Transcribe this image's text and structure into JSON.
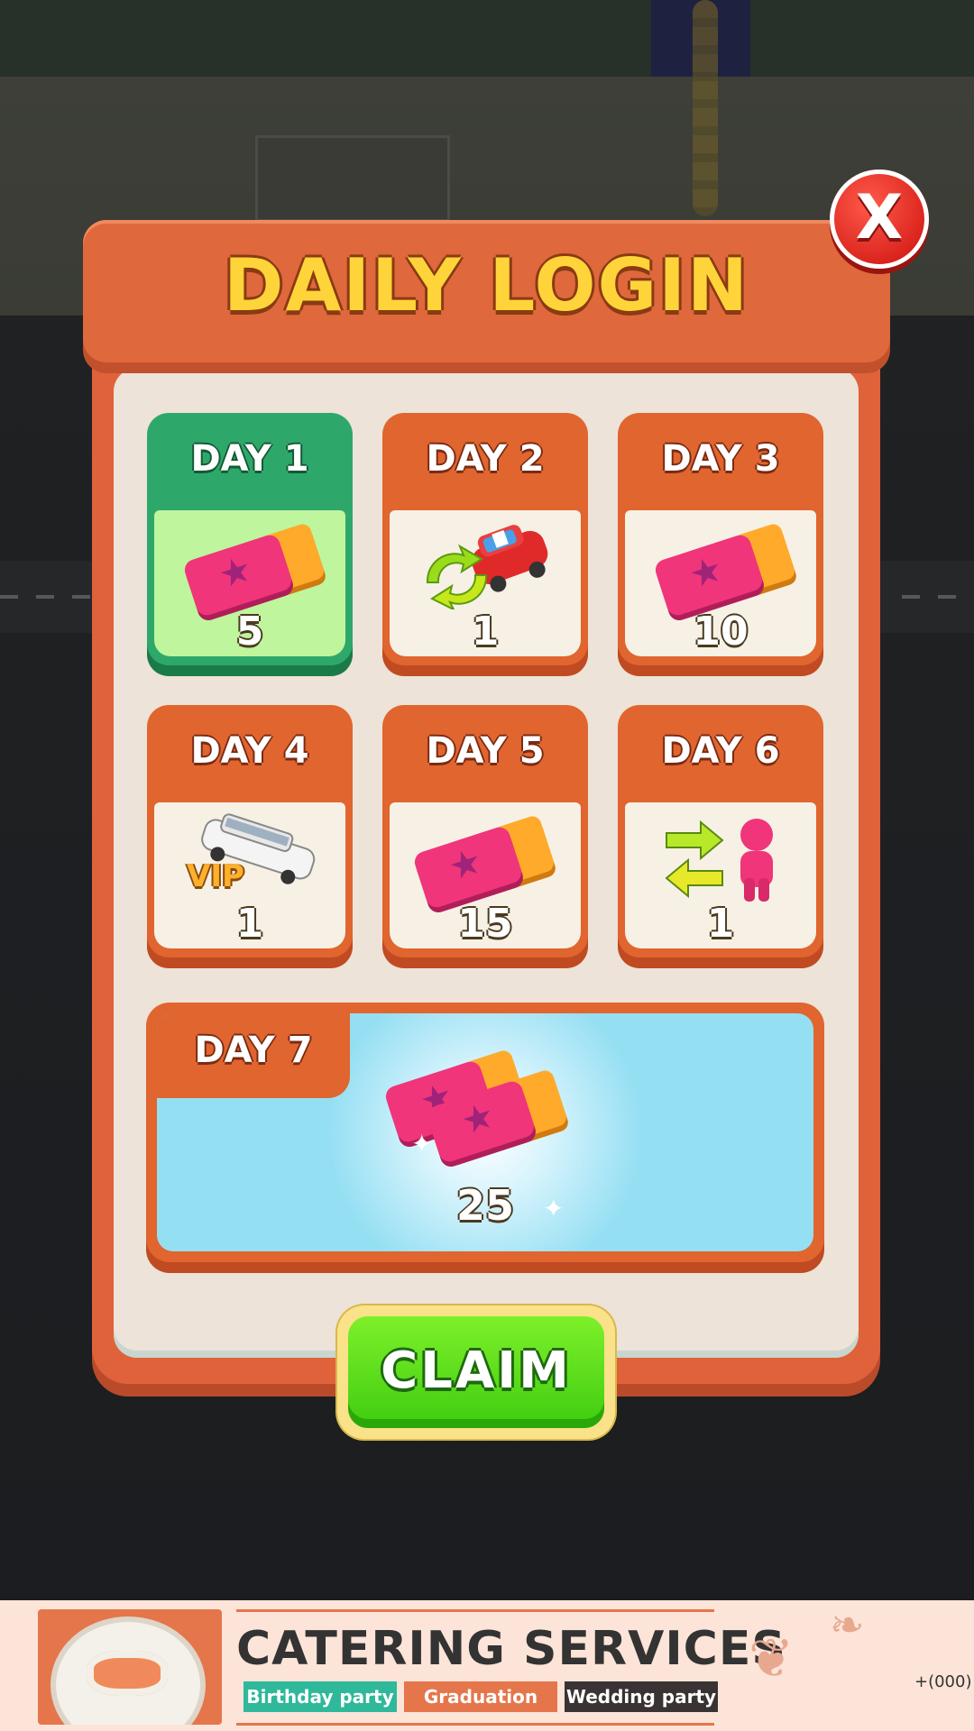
{
  "title": "DAILY LOGIN",
  "close_label": "X",
  "days": [
    {
      "label": "DAY 1",
      "amount": "5",
      "reward": "ticket-icon",
      "claimed": true
    },
    {
      "label": "DAY 2",
      "amount": "1",
      "reward": "car-swap-icon",
      "claimed": false
    },
    {
      "label": "DAY 3",
      "amount": "10",
      "reward": "ticket-icon",
      "claimed": false
    },
    {
      "label": "DAY 4",
      "amount": "1",
      "reward": "vip-limo-icon",
      "claimed": false
    },
    {
      "label": "DAY 5",
      "amount": "15",
      "reward": "ticket-icon",
      "claimed": false
    },
    {
      "label": "DAY 6",
      "amount": "1",
      "reward": "passenger-swap-icon",
      "claimed": false
    }
  ],
  "day7": {
    "label": "DAY 7",
    "amount": "25",
    "reward": "ticket-stack-icon"
  },
  "vip_text": "VIP",
  "claim_label": "CLAIM",
  "ad": {
    "headline": "CATERING SERVICES",
    "tags": [
      "Birthday party",
      "Graduation",
      "Wedding party"
    ],
    "phone": "+(000)"
  },
  "colors": {
    "header": "#e0683d",
    "claimed": "#2ea86a",
    "claim_button": "#5fdc1a",
    "title_text": "#ffd43a"
  }
}
